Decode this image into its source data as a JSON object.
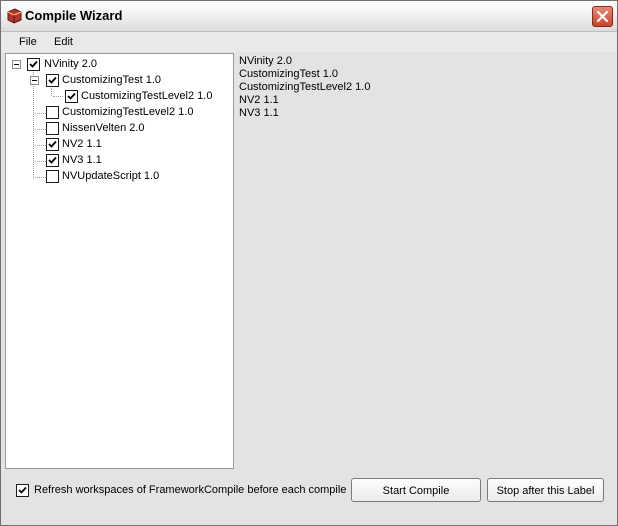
{
  "window": {
    "title": "Compile Wizard"
  },
  "menu": {
    "file": "File",
    "edit": "Edit"
  },
  "tree": {
    "root": {
      "label": "NVinity 2.0",
      "checked": true,
      "expanded": true
    },
    "customizing": {
      "label": "CustomizingTest 1.0",
      "checked": true,
      "expanded": true
    },
    "customizing_level2_child": {
      "label": "CustomizingTestLevel2 1.0",
      "checked": true
    },
    "customizing_level2": {
      "label": "CustomizingTestLevel2 1.0",
      "checked": false
    },
    "nissen": {
      "label": "NissenVelten 2.0",
      "checked": false
    },
    "nv2": {
      "label": "NV2 1.1",
      "checked": true
    },
    "nv3": {
      "label": "NV3 1.1",
      "checked": true
    },
    "update": {
      "label": "NVUpdateScript 1.0",
      "checked": false
    }
  },
  "compile_list": [
    "NVinity 2.0",
    "CustomizingTest 1.0",
    "CustomizingTestLevel2 1.0",
    "NV2 1.1",
    "NV3 1.1"
  ],
  "footer": {
    "refresh_label": "Refresh workspaces of FrameworkCompile before each compile",
    "refresh_checked": true,
    "start_button": "Start Compile",
    "stop_button": "Stop after this Label"
  }
}
